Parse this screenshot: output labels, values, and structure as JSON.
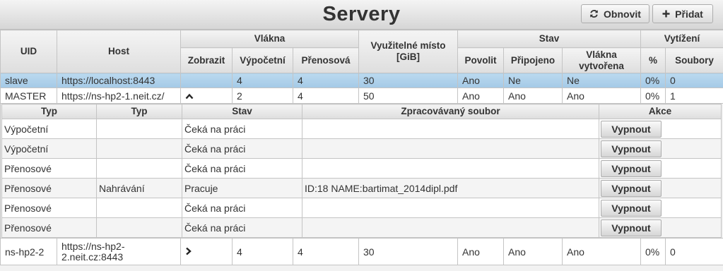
{
  "header": {
    "title": "Servery",
    "refresh_label": "Obnovit",
    "add_label": "Přidat"
  },
  "columns": {
    "uid": "UID",
    "host": "Host",
    "threads": "Vlákna",
    "threads_show": "Zobrazit",
    "threads_compute": "Výpočetní",
    "threads_transfer": "Přenosová",
    "space": "Využitelné místo [GiB]",
    "state": "Stav",
    "state_allow": "Povolit",
    "state_connected": "Připojeno",
    "state_threads_created": "Vlákna vytvořena",
    "load": "Vytížení",
    "load_pct": "%",
    "load_files": "Soubory"
  },
  "servers": [
    {
      "uid": "slave",
      "host": "https://localhost:8443",
      "show": "",
      "compute": "4",
      "transfer": "4",
      "space": "30",
      "allow": "Ano",
      "connected": "Ne",
      "created": "Ne",
      "pct": "0%",
      "files": "0"
    },
    {
      "uid": "MASTER",
      "host": "https://ns-hp2-1.neit.cz/",
      "show": "expanded",
      "compute": "2",
      "transfer": "4",
      "space": "50",
      "allow": "Ano",
      "connected": "Ano",
      "created": "Ano",
      "pct": "0%",
      "files": "1"
    },
    {
      "uid": "ns-hp2-2",
      "host": "https://ns-hp2-2.neit.cz:8443",
      "show": "collapsed",
      "compute": "4",
      "transfer": "4",
      "space": "30",
      "allow": "Ano",
      "connected": "Ano",
      "created": "Ano",
      "pct": "0%",
      "files": "0"
    }
  ],
  "threads_table": {
    "headers": {
      "type": "Typ",
      "subtype": "Typ",
      "state": "Stav",
      "file": "Zpracovávaný soubor",
      "action": "Akce"
    },
    "button_label": "Vypnout",
    "rows": [
      {
        "type": "Výpočetní",
        "subtype": "",
        "state": "Čeká na práci",
        "file": ""
      },
      {
        "type": "Výpočetní",
        "subtype": "",
        "state": "Čeká na práci",
        "file": ""
      },
      {
        "type": "Přenosové",
        "subtype": "",
        "state": "Čeká na práci",
        "file": ""
      },
      {
        "type": "Přenosové",
        "subtype": "Nahrávání",
        "state": "Pracuje",
        "file": "ID:18 NAME:bartimat_2014dipl.pdf"
      },
      {
        "type": "Přenosové",
        "subtype": "",
        "state": "Čeká na práci",
        "file": ""
      },
      {
        "type": "Přenosové",
        "subtype": "",
        "state": "Čeká na práci",
        "file": ""
      }
    ]
  },
  "icons": {
    "refresh": "refresh-icon",
    "add": "plus-icon",
    "expanded": "chevron-up-icon",
    "collapsed": "chevron-right-icon"
  }
}
